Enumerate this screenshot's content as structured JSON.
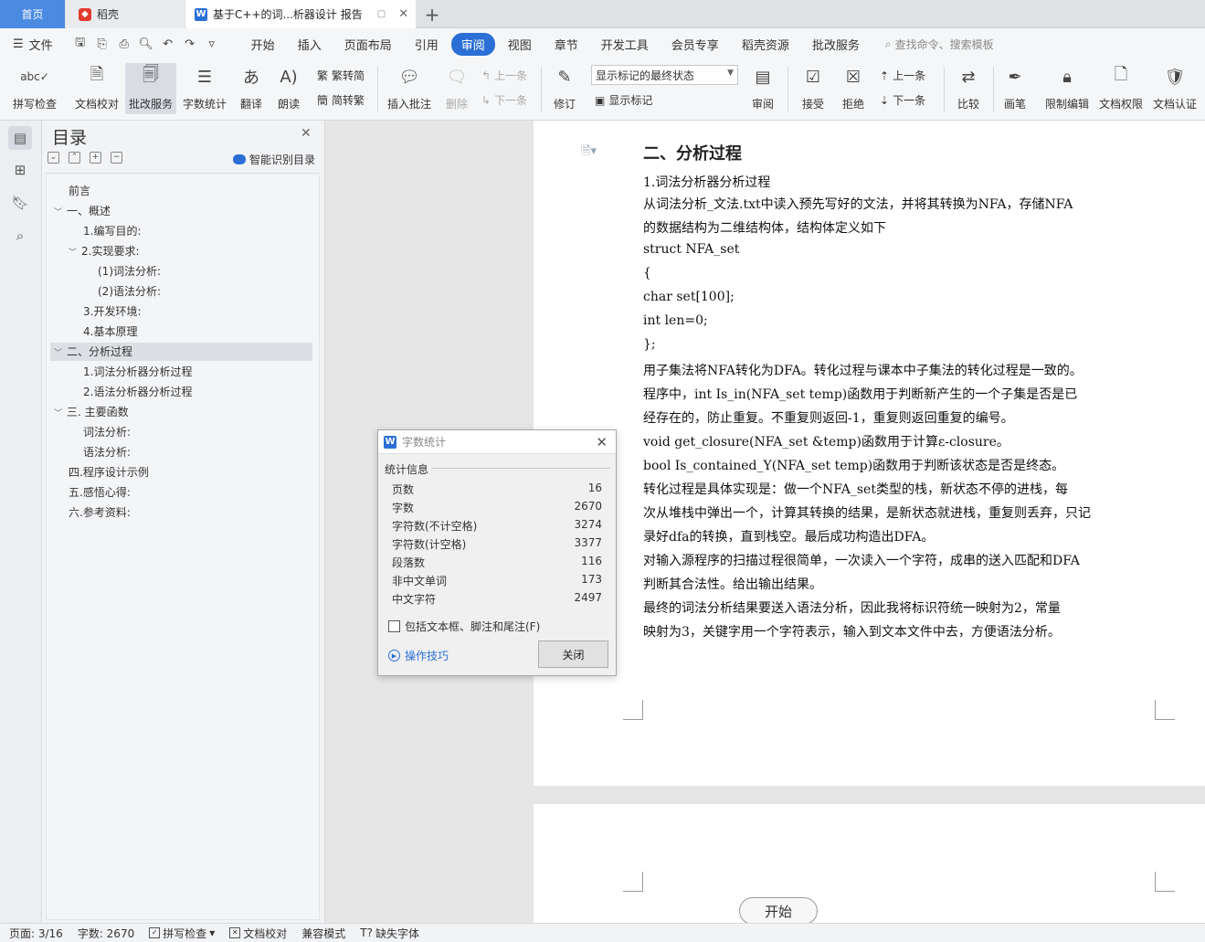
{
  "tabs": {
    "home": "首页",
    "daoke": "稻壳",
    "doc": "基于C++的词...析器设计 报告"
  },
  "menu": {
    "file": "文件",
    "items": [
      "开始",
      "插入",
      "页面布局",
      "引用",
      "审阅",
      "视图",
      "章节",
      "开发工具",
      "会员专享",
      "稻壳资源",
      "批改服务"
    ],
    "active": "审阅",
    "search": "查找命令、搜索模板"
  },
  "ribbon": {
    "spellcheck": "拼写检查",
    "doccheck": "文档校对",
    "correction": "批改服务",
    "wordcount": "字数统计",
    "translate": "翻译",
    "read": "朗读",
    "to_simplified": "繁转简",
    "to_traditional": "简转繁",
    "insert_comment": "插入批注",
    "delete": "删除",
    "prev": "上一条",
    "next": "下一条",
    "revise": "修订",
    "markup_combo": "显示标记的最终状态",
    "show_markup": "显示标记",
    "review": "审阅",
    "accept": "接受",
    "reject": "拒绝",
    "prev2": "上一条",
    "next2": "下一条",
    "compare": "比较",
    "pen": "画笔",
    "restrict": "限制编辑",
    "permission": "文档权限",
    "certify": "文档认证"
  },
  "nav": {
    "title": "目录",
    "smart": "智能识别目录",
    "items": [
      "前言",
      "一、概述",
      "1.编写目的:",
      "2.实现要求:",
      "(1)词法分析:",
      "(2)语法分析:",
      "3.开发环境:",
      "4.基本原理",
      "二、分析过程",
      "1.词法分析器分析过程",
      "2.语法分析器分析过程",
      "三. 主要函数",
      "词法分析:",
      "语法分析:",
      "四.程序设计示例",
      "五.感悟心得:",
      "六.参考资料:"
    ]
  },
  "document": {
    "heading": "二、分析过程",
    "lines": [
      "1.词法分析器分析过程",
      "    从词法分析_文法.txt中读入预先写好的文法，并将其转换为NFA，存储NFA",
      "的数据结构为二维结构体，结构体定义如下",
      "    struct NFA_set",
      "    {",
      "        char set[100];",
      "        int len=0;",
      "    };",
      "    用子集法将NFA转化为DFA。转化过程与课本中子集法的转化过程是一致的。",
      "    程序中，int Is_in(NFA_set temp)函数用于判断新产生的一个子集是否是已",
      "经存在的，防止重复。不重复则返回-1，重复则返回重复的编号。",
      "    void get_closure(NFA_set &temp)函数用于计算ε-closure。",
      "    bool Is_contained_Y(NFA_set temp)函数用于判断该状态是否是终态。",
      "    转化过程是具体实现是：做一个NFA_set类型的栈，新状态不停的进栈，每",
      "次从堆栈中弹出一个，计算其转换的结果，是新状态就进栈，重复则丢弃，只记",
      "录好dfa的转换，直到栈空。最后成功构造出DFA。",
      "    对输入源程序的扫描过程很简单，一次读入一个字符，成串的送入匹配和DFA",
      "判断其合法性。给出输出结果。",
      "    最终的词法分析结果要送入语法分析，因此我将标识符统一映射为2，常量",
      "映射为3，关键字用一个字符表示，输入到文本文件中去，方便语法分析。"
    ]
  },
  "dialog": {
    "title": "字数统计",
    "section": "统计信息",
    "stats": [
      {
        "label": "页数",
        "value": "16"
      },
      {
        "label": "字数",
        "value": "2670"
      },
      {
        "label": "字符数(不计空格)",
        "value": "3274"
      },
      {
        "label": "字符数(计空格)",
        "value": "3377"
      },
      {
        "label": "段落数",
        "value": "116"
      },
      {
        "label": "非中文单词",
        "value": "173"
      },
      {
        "label": "中文字符",
        "value": "2497"
      }
    ],
    "checkbox": "包括文本框、脚注和尾注(F)",
    "tips": "操作技巧",
    "close": "关闭"
  },
  "start_button": "开始",
  "status": {
    "page": "页面: 3/16",
    "words": "字数: 2670",
    "spell": "拼写检查",
    "doccheck": "文档校对",
    "compat": "兼容模式",
    "missing_font": "缺失字体"
  },
  "colors": {
    "accent": "#2b6fd6",
    "home_tab": "#4a8ae0"
  }
}
